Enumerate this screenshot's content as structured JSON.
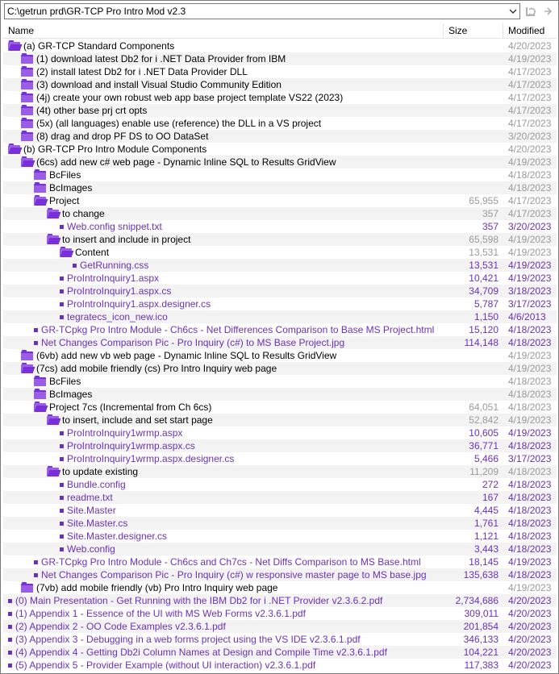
{
  "pathbar": {
    "path": "C:\\getrun prd\\GR-TCP Pro Intro Mod v2.3"
  },
  "header": {
    "name": "Name",
    "size": "Size",
    "modified": "Modified"
  },
  "icons": {
    "dropdown": "chevron-down-icon",
    "refresh": "refresh-icon",
    "folder": "folder-icon",
    "folder_open": "folder-open-icon",
    "file": "file-bullet-icon"
  },
  "rows": [
    {
      "name": "(a) GR-TCP Standard Components",
      "size": "",
      "modified": "4/20/2023",
      "level": 0,
      "type": "folder-open"
    },
    {
      "name": "(1) download latest Db2 for i .NET Data Provider from IBM",
      "size": "",
      "modified": "4/19/2023",
      "level": 1,
      "type": "folder"
    },
    {
      "name": "(2) install latest Db2 for i .NET Data Provider DLL",
      "size": "",
      "modified": "4/17/2023",
      "level": 1,
      "type": "folder"
    },
    {
      "name": "(3) download and install Visual Studio Community Edition",
      "size": "",
      "modified": "4/17/2023",
      "level": 1,
      "type": "folder"
    },
    {
      "name": "(4j) create your own robust web app base project template VS22 (2023)",
      "size": "",
      "modified": "4/17/2023",
      "level": 1,
      "type": "folder"
    },
    {
      "name": "(4t) other base prj crt opts",
      "size": "",
      "modified": "4/17/2023",
      "level": 1,
      "type": "folder"
    },
    {
      "name": "(5x) (all languages) enable use (reference) the DLL in a VS project",
      "size": "",
      "modified": "4/17/2023",
      "level": 1,
      "type": "folder"
    },
    {
      "name": "(8) drag and drop PF DS to OO DataSet",
      "size": "",
      "modified": "3/20/2023",
      "level": 1,
      "type": "folder"
    },
    {
      "name": "(b) GR-TCP Pro Intro Module Components",
      "size": "",
      "modified": "4/20/2023",
      "level": 0,
      "type": "folder-open"
    },
    {
      "name": "(6cs) add new c# web page - Dynamic Inline SQL to Results GridView",
      "size": "",
      "modified": "4/19/2023",
      "level": 1,
      "type": "folder-open"
    },
    {
      "name": "BcFiles",
      "size": "",
      "modified": "4/18/2023",
      "level": 2,
      "type": "folder"
    },
    {
      "name": "BcImages",
      "size": "",
      "modified": "4/18/2023",
      "level": 2,
      "type": "folder"
    },
    {
      "name": "Project",
      "size": "65,955",
      "modified": "4/17/2023",
      "level": 2,
      "type": "folder-open"
    },
    {
      "name": "to change",
      "size": "357",
      "modified": "4/17/2023",
      "level": 3,
      "type": "folder-open"
    },
    {
      "name": "Web.config snippet.txt",
      "size": "357",
      "modified": "3/20/2023",
      "level": 4,
      "type": "file"
    },
    {
      "name": "to insert and include in project",
      "size": "65,598",
      "modified": "4/19/2023",
      "level": 3,
      "type": "folder-open"
    },
    {
      "name": "Content",
      "size": "13,531",
      "modified": "4/19/2023",
      "level": 4,
      "type": "folder-open"
    },
    {
      "name": "GetRunning.css",
      "size": "13,531",
      "modified": "4/19/2023",
      "level": 5,
      "type": "file"
    },
    {
      "name": "ProIntroInquiry1.aspx",
      "size": "10,421",
      "modified": "4/19/2023",
      "level": 4,
      "type": "file"
    },
    {
      "name": "ProIntroInquiry1.aspx.cs",
      "size": "34,709",
      "modified": "3/18/2023",
      "level": 4,
      "type": "file"
    },
    {
      "name": "ProIntroInquiry1.aspx.designer.cs",
      "size": "5,787",
      "modified": "3/17/2023",
      "level": 4,
      "type": "file"
    },
    {
      "name": "tegratecs_icon_new.ico",
      "size": "1,150",
      "modified": "4/6/2013",
      "level": 4,
      "type": "file"
    },
    {
      "name": "GR-TCpkg Pro Intro Module - Ch6cs - Net Differences Comparison to Base MS Project.html",
      "size": "15,120",
      "modified": "4/18/2023",
      "level": 2,
      "type": "file"
    },
    {
      "name": "Net Changes Comparison Pic - Pro Inquiry (c#) to MS Base Project.jpg",
      "size": "114,148",
      "modified": "4/18/2023",
      "level": 2,
      "type": "file"
    },
    {
      "name": "(6vb) add new vb web page - Dynamic Inline SQL to Results GridView",
      "size": "",
      "modified": "4/19/2023",
      "level": 1,
      "type": "folder"
    },
    {
      "name": "(7cs) add mobile friendly (cs) Pro Intro Inquiry web page",
      "size": "",
      "modified": "4/19/2023",
      "level": 1,
      "type": "folder-open"
    },
    {
      "name": "BcFiles",
      "size": "",
      "modified": "4/18/2023",
      "level": 2,
      "type": "folder"
    },
    {
      "name": "BcImages",
      "size": "",
      "modified": "4/18/2023",
      "level": 2,
      "type": "folder"
    },
    {
      "name": "Project 7cs (Incremental from Ch 6cs)",
      "size": "64,051",
      "modified": "4/18/2023",
      "level": 2,
      "type": "folder-open"
    },
    {
      "name": "to insert, include and set start page",
      "size": "52,842",
      "modified": "4/19/2023",
      "level": 3,
      "type": "folder-open"
    },
    {
      "name": "ProIntroInquiry1wrmp.aspx",
      "size": "10,605",
      "modified": "4/19/2023",
      "level": 4,
      "type": "file"
    },
    {
      "name": "ProIntroInquiry1wrmp.aspx.cs",
      "size": "36,771",
      "modified": "4/18/2023",
      "level": 4,
      "type": "file"
    },
    {
      "name": "ProIntroInquiry1wrmp.aspx.designer.cs",
      "size": "5,466",
      "modified": "3/17/2023",
      "level": 4,
      "type": "file"
    },
    {
      "name": "to update existing",
      "size": "11,209",
      "modified": "4/18/2023",
      "level": 3,
      "type": "folder-open"
    },
    {
      "name": "Bundle.config",
      "size": "272",
      "modified": "4/18/2023",
      "level": 4,
      "type": "file"
    },
    {
      "name": "readme.txt",
      "size": "167",
      "modified": "4/18/2023",
      "level": 4,
      "type": "file"
    },
    {
      "name": "Site.Master",
      "size": "4,445",
      "modified": "4/18/2023",
      "level": 4,
      "type": "file"
    },
    {
      "name": "Site.Master.cs",
      "size": "1,761",
      "modified": "4/18/2023",
      "level": 4,
      "type": "file"
    },
    {
      "name": "Site.Master.designer.cs",
      "size": "1,121",
      "modified": "4/18/2023",
      "level": 4,
      "type": "file"
    },
    {
      "name": "Web.config",
      "size": "3,443",
      "modified": "4/18/2023",
      "level": 4,
      "type": "file"
    },
    {
      "name": "GR-TCpkg Pro Intro Module - Ch6cs and Ch7cs - Net Diffs Comparison to MS Base.html",
      "size": "18,145",
      "modified": "4/19/2023",
      "level": 2,
      "type": "file"
    },
    {
      "name": "Net Changes Comparison Pic - Pro Inquiry (c#) w responsive master page to MS base.jpg",
      "size": "135,638",
      "modified": "4/18/2023",
      "level": 2,
      "type": "file"
    },
    {
      "name": "(7vb) add mobile friendly (vb) Pro Intro Inquiry web page",
      "size": "",
      "modified": "4/19/2023",
      "level": 1,
      "type": "folder"
    },
    {
      "name": "(0) Main Presentation - Get Running with the IBM Db2 for i .NET Provider v2.3.6.2.pdf",
      "size": "2,734,686",
      "modified": "4/20/2023",
      "level": 0,
      "type": "file"
    },
    {
      "name": "(1) Appendix 1 - Essence of the UI with MS Web Forms v2.3.6.1.pdf",
      "size": "309,011",
      "modified": "4/20/2023",
      "level": 0,
      "type": "file"
    },
    {
      "name": "(2) Appendix 2 - OO Code Examples v2.3.6.1.pdf",
      "size": "201,854",
      "modified": "4/20/2023",
      "level": 0,
      "type": "file"
    },
    {
      "name": "(3) Appendix 3 - Debugging in a web forms project using the VS IDE v2.3.6.1.pdf",
      "size": "346,133",
      "modified": "4/20/2023",
      "level": 0,
      "type": "file"
    },
    {
      "name": "(4) Appendix 4 - Getting Db2i Column Names at Design and Compile Time v2.3.6.1.pdf",
      "size": "104,221",
      "modified": "4/20/2023",
      "level": 0,
      "type": "file"
    },
    {
      "name": "(5) Appendix 5 - Provider Example (without UI interaction) v2.3.6.1.pdf",
      "size": "117,383",
      "modified": "4/20/2023",
      "level": 0,
      "type": "file"
    }
  ]
}
